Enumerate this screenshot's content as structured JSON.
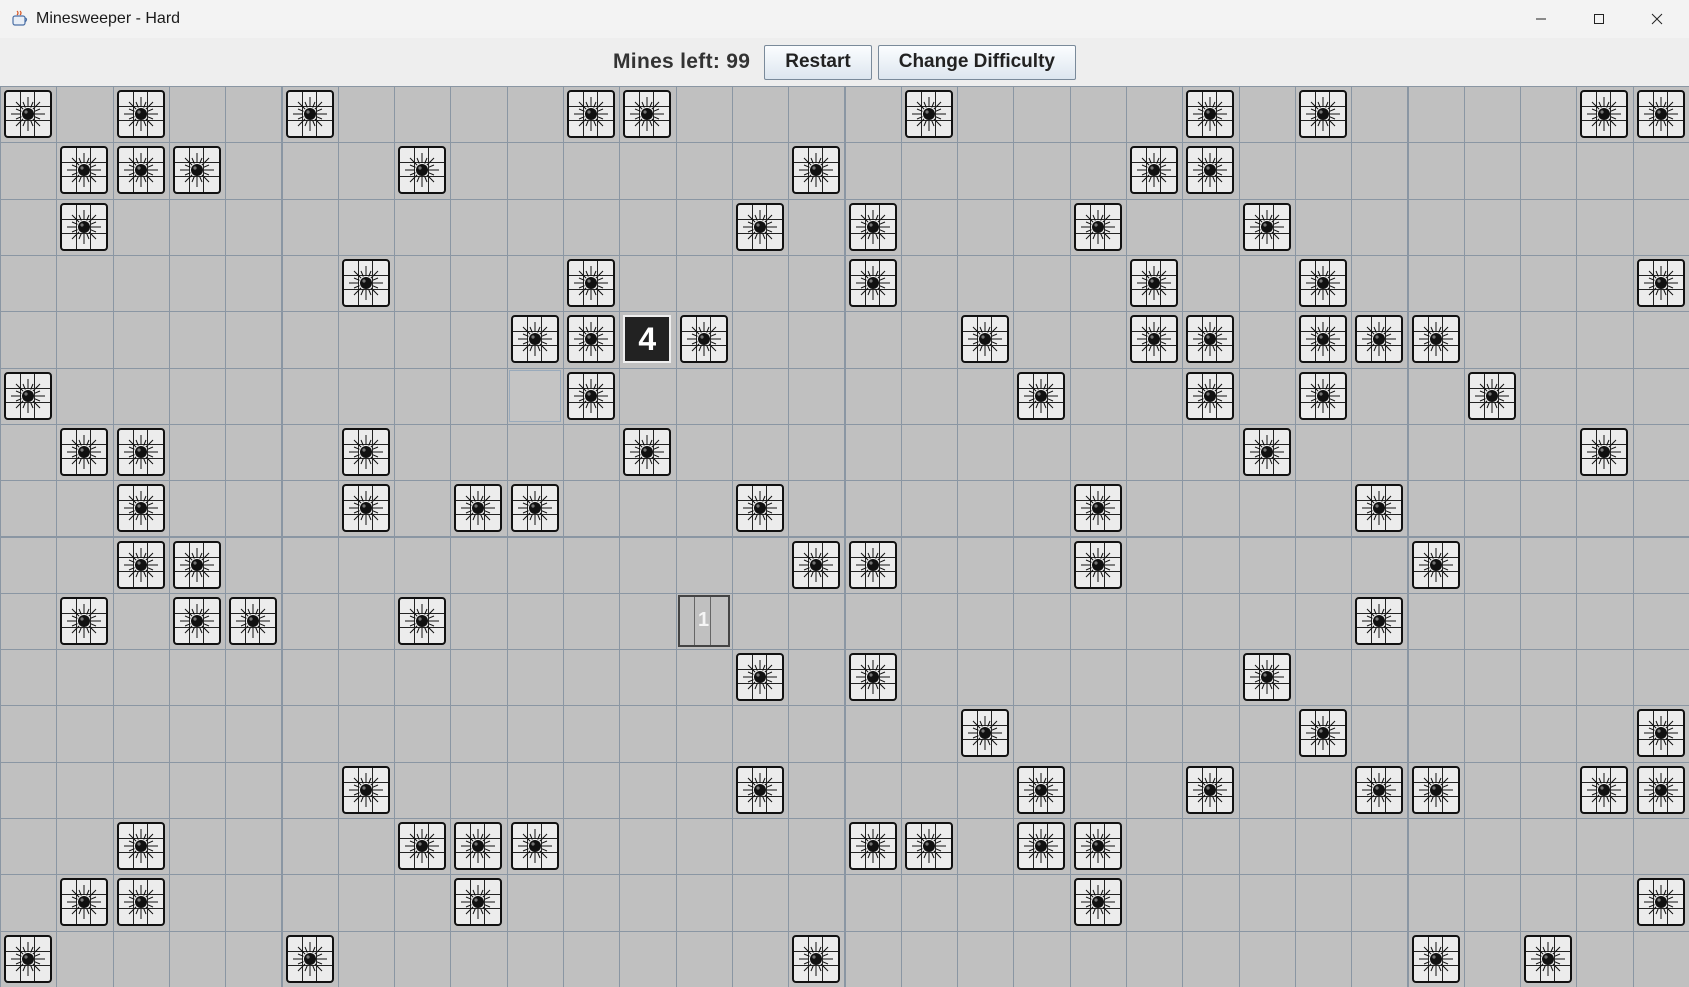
{
  "window": {
    "title": "Minesweeper - Hard",
    "app_icon": "java-icon",
    "controls": [
      "minimize-icon",
      "maximize-icon",
      "close-icon"
    ]
  },
  "toolbar": {
    "mines_left": "Mines left: 99",
    "restart_label": "Restart",
    "change_difficulty_label": "Change Difficulty"
  },
  "board": {
    "cols": 30,
    "rows": 16,
    "mines": [
      [
        0,
        0
      ],
      [
        0,
        2
      ],
      [
        0,
        5
      ],
      [
        0,
        10
      ],
      [
        0,
        11
      ],
      [
        0,
        16
      ],
      [
        0,
        21
      ],
      [
        0,
        23
      ],
      [
        0,
        28
      ],
      [
        0,
        29
      ],
      [
        1,
        1
      ],
      [
        1,
        2
      ],
      [
        1,
        3
      ],
      [
        1,
        7
      ],
      [
        1,
        14
      ],
      [
        1,
        20
      ],
      [
        1,
        21
      ],
      [
        2,
        1
      ],
      [
        2,
        13
      ],
      [
        2,
        15
      ],
      [
        2,
        19
      ],
      [
        2,
        22
      ],
      [
        3,
        6
      ],
      [
        3,
        10
      ],
      [
        3,
        15
      ],
      [
        3,
        20
      ],
      [
        3,
        23
      ],
      [
        3,
        29
      ],
      [
        4,
        9
      ],
      [
        4,
        10
      ],
      [
        4,
        12
      ],
      [
        4,
        17
      ],
      [
        4,
        20
      ],
      [
        4,
        21
      ],
      [
        4,
        23
      ],
      [
        4,
        24
      ],
      [
        4,
        25
      ],
      [
        5,
        0
      ],
      [
        5,
        10
      ],
      [
        5,
        18
      ],
      [
        5,
        21
      ],
      [
        5,
        23
      ],
      [
        5,
        26
      ],
      [
        6,
        1
      ],
      [
        6,
        2
      ],
      [
        6,
        6
      ],
      [
        6,
        11
      ],
      [
        6,
        22
      ],
      [
        6,
        28
      ],
      [
        7,
        2
      ],
      [
        7,
        6
      ],
      [
        7,
        8
      ],
      [
        7,
        9
      ],
      [
        7,
        13
      ],
      [
        7,
        19
      ],
      [
        7,
        24
      ],
      [
        8,
        2
      ],
      [
        8,
        3
      ],
      [
        8,
        14
      ],
      [
        8,
        15
      ],
      [
        8,
        19
      ],
      [
        8,
        25
      ],
      [
        9,
        1
      ],
      [
        9,
        3
      ],
      [
        9,
        4
      ],
      [
        9,
        7
      ],
      [
        9,
        24
      ],
      [
        10,
        13
      ],
      [
        10,
        15
      ],
      [
        10,
        22
      ],
      [
        11,
        17
      ],
      [
        11,
        23
      ],
      [
        11,
        29
      ],
      [
        12,
        6
      ],
      [
        12,
        13
      ],
      [
        12,
        18
      ],
      [
        12,
        21
      ],
      [
        12,
        24
      ],
      [
        12,
        25
      ],
      [
        12,
        28
      ],
      [
        12,
        29
      ],
      [
        13,
        2
      ],
      [
        13,
        7
      ],
      [
        13,
        8
      ],
      [
        13,
        9
      ],
      [
        13,
        15
      ],
      [
        13,
        16
      ],
      [
        13,
        18
      ],
      [
        13,
        19
      ],
      [
        14,
        1
      ],
      [
        14,
        2
      ],
      [
        14,
        8
      ],
      [
        14,
        19
      ],
      [
        14,
        29
      ],
      [
        15,
        0
      ],
      [
        15,
        5
      ],
      [
        15,
        14
      ],
      [
        15,
        25
      ],
      [
        15,
        27
      ]
    ],
    "numbers": [
      {
        "row": 4,
        "col": 11,
        "value": "4"
      },
      {
        "row": 9,
        "col": 12,
        "value": "1"
      }
    ],
    "hover": [
      5,
      9
    ]
  }
}
